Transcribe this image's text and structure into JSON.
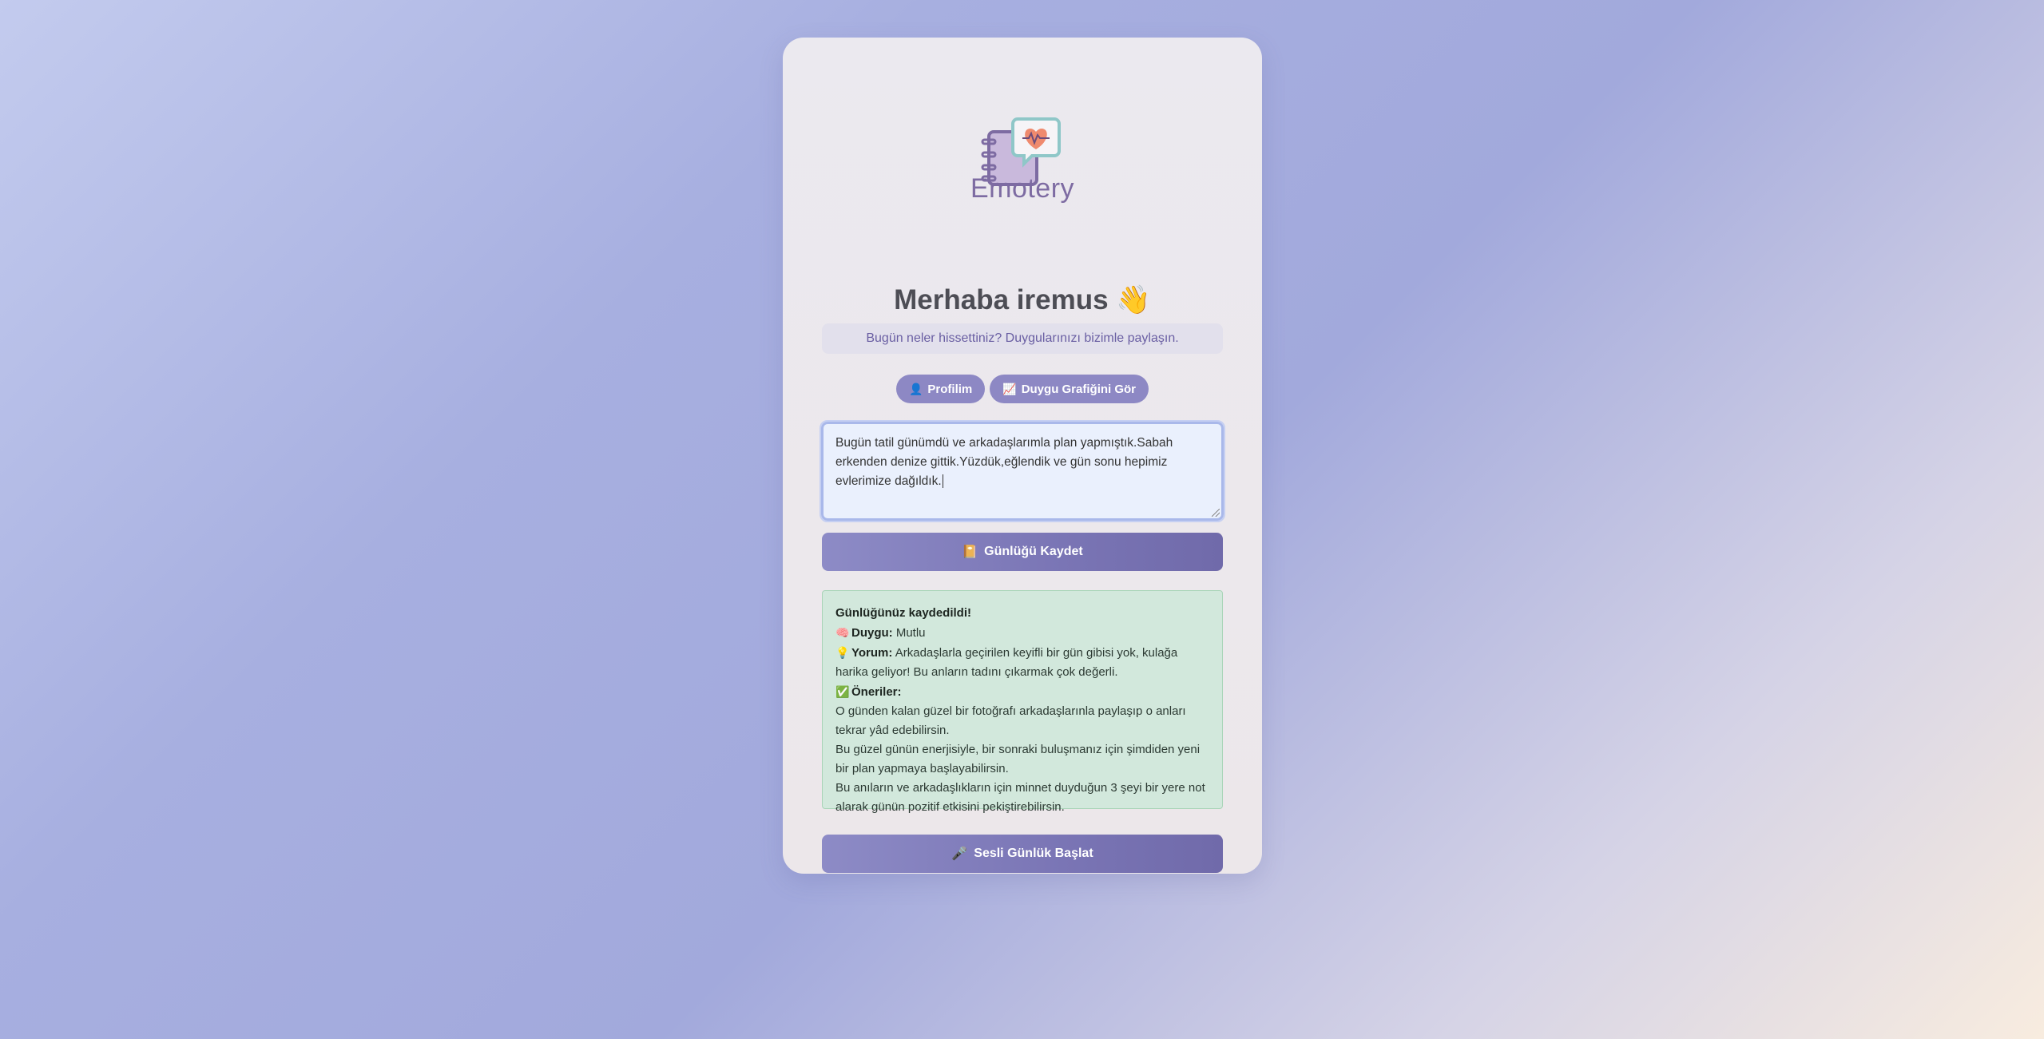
{
  "app": {
    "brand": "Emotery",
    "greeting": "Merhaba iremus 👋",
    "subtitle": "Bugün neler hissettiniz? Duygularınızı bizimle paylaşın."
  },
  "nav": {
    "profile_icon": "👤",
    "profile_label": "Profilim",
    "chart_icon": "📈",
    "chart_label": "Duygu Grafiğini Gör"
  },
  "diary": {
    "text": "Bugün tatil günümdü ve arkadaşlarımla plan yapmıştık.Sabah erkenden denize gittik.Yüzdük,eğlendik ve gün sonu hepimiz evlerimize dağıldık."
  },
  "save_button": {
    "icon": "📔",
    "label": "Günlüğü Kaydet"
  },
  "result": {
    "title": "Günlüğünüz kaydedildi!",
    "emotion_icon": "🧠",
    "emotion_label": "Duygu:",
    "emotion_value": "Mutlu",
    "comment_icon": "💡",
    "comment_label": "Yorum:",
    "comment_value": "Arkadaşlarla geçirilen keyifli bir gün gibisi yok, kulağa harika geliyor! Bu anların tadını çıkarmak çok değerli.",
    "suggestions_icon": "✅",
    "suggestions_label": "Öneriler:",
    "suggestions": [
      "O günden kalan güzel bir fotoğrafı arkadaşlarınla paylaşıp o anları tekrar yâd edebilirsin.",
      "Bu güzel günün enerjisiyle, bir sonraki buluşmanız için şimdiden yeni bir plan yapmaya başlayabilirsin.",
      "Bu anıların ve arkadaşlıkların için minnet duyduğun 3 şeyi bir yere not alarak günün pozitif etkisini pekiştirebilirsin."
    ]
  },
  "voice_button": {
    "icon": "🎤",
    "label": "Sesli Günlük Başlat"
  }
}
